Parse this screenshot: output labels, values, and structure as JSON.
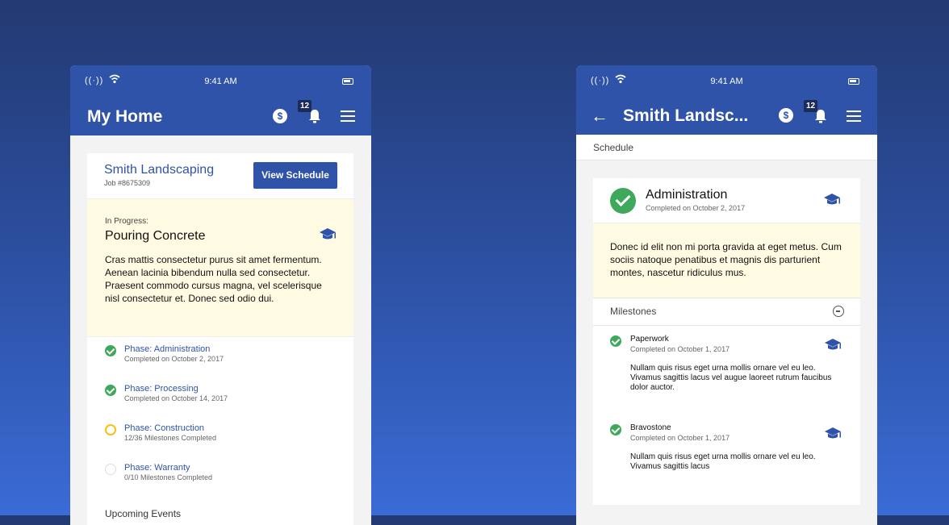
{
  "status": {
    "time": "9:41 AM",
    "signal": "((·))"
  },
  "phone1": {
    "title": "My Home",
    "coin_symbol": "$",
    "badge_count": "12",
    "job": {
      "name": "Smith Landscaping",
      "number": "Job #8675309",
      "button": "View Schedule"
    },
    "in_progress": {
      "label": "In Progress:",
      "title": "Pouring Concrete",
      "body": "Cras mattis consectetur purus sit amet fermentum. Aenean lacinia bibendum nulla sed consectetur. Praesent commodo cursus magna, vel scelerisque nisl consectetur et. Donec sed odio dui."
    },
    "phases": [
      {
        "name": "Phase: Administration",
        "sub": "Completed on October 2, 2017",
        "state": "done"
      },
      {
        "name": "Phase: Processing",
        "sub": "Completed on October 14, 2017",
        "state": "done"
      },
      {
        "name": "Phase: Construction",
        "sub": "12/36 Milestones Completed",
        "state": "in-progress"
      },
      {
        "name": "Phase: Warranty",
        "sub": "0/10 Milestones Completed",
        "state": "todo"
      }
    ],
    "upcoming": "Upcoming Events"
  },
  "phone2": {
    "title": "Smith Landsc...",
    "coin_symbol": "$",
    "badge_count": "12",
    "schedule_label": "Schedule",
    "phase": {
      "title": "Administration",
      "sub": "Completed on October 2, 2017",
      "body": "Donec id elit non mi porta gravida at eget metus. Cum sociis natoque penatibus et magnis dis parturient montes, nascetur ridiculus mus."
    },
    "milestones_label": "Milestones",
    "milestones": [
      {
        "name": "Paperwork",
        "sub": "Completed on October 1, 2017",
        "body": "Nullam quis risus eget urna mollis ornare vel eu leo. Vivamus sagittis lacus vel augue laoreet rutrum faucibus dolor auctor."
      },
      {
        "name": "Bravostone",
        "sub": "Completed on October 1, 2017",
        "body": "Nullam quis risus eget urna mollis ornare vel eu leo. Vivamus sagittis lacus"
      }
    ]
  },
  "colors": {
    "brand": "#2e53a9",
    "success": "#3ea85b",
    "warning": "#f2c21b",
    "highlight_bg": "#fffbe2"
  },
  "icons": [
    "signal-icon",
    "wifi-icon",
    "battery-icon",
    "coin-icon",
    "bell-icon",
    "menu-icon",
    "back-arrow-icon",
    "graduation-cap-icon",
    "check-icon",
    "collapse-icon"
  ]
}
